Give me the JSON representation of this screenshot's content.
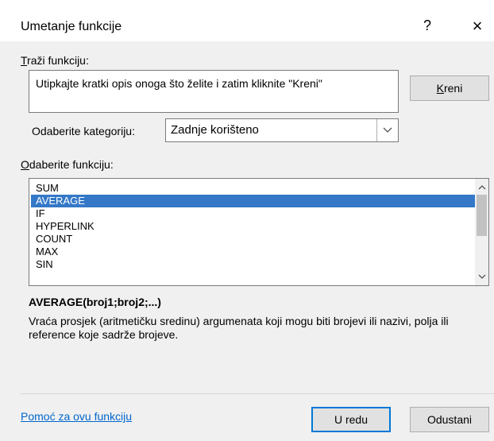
{
  "window": {
    "title": "Umetanje funkcije",
    "help_label": "?",
    "close_label": "×"
  },
  "search": {
    "label": "Traži funkciju:",
    "value": "Utipkajte kratki opis onoga što želite i zatim kliknite \"Kreni\"",
    "go_button": "Kreni"
  },
  "category": {
    "label": "Odaberite kategoriju:",
    "selected": "Zadnje korišteno"
  },
  "functions": {
    "label": "Odaberite funkciju:",
    "items": [
      "SUM",
      "AVERAGE",
      "IF",
      "HYPERLINK",
      "COUNT",
      "MAX",
      "SIN"
    ],
    "selected_index": 1
  },
  "description": {
    "signature": "AVERAGE(broj1;broj2;...)",
    "text": "Vraća prosjek (aritmetičku sredinu) argumenata koji mogu biti brojevi ili nazivi, polja ili reference koje sadrže brojeve."
  },
  "footer": {
    "help_link": "Pomoć za ovu funkciju",
    "ok_button": "U redu",
    "cancel_button": "Odustani"
  },
  "colors": {
    "selection": "#3478c7",
    "link": "#0066cc",
    "primary_border": "#0078d7"
  }
}
